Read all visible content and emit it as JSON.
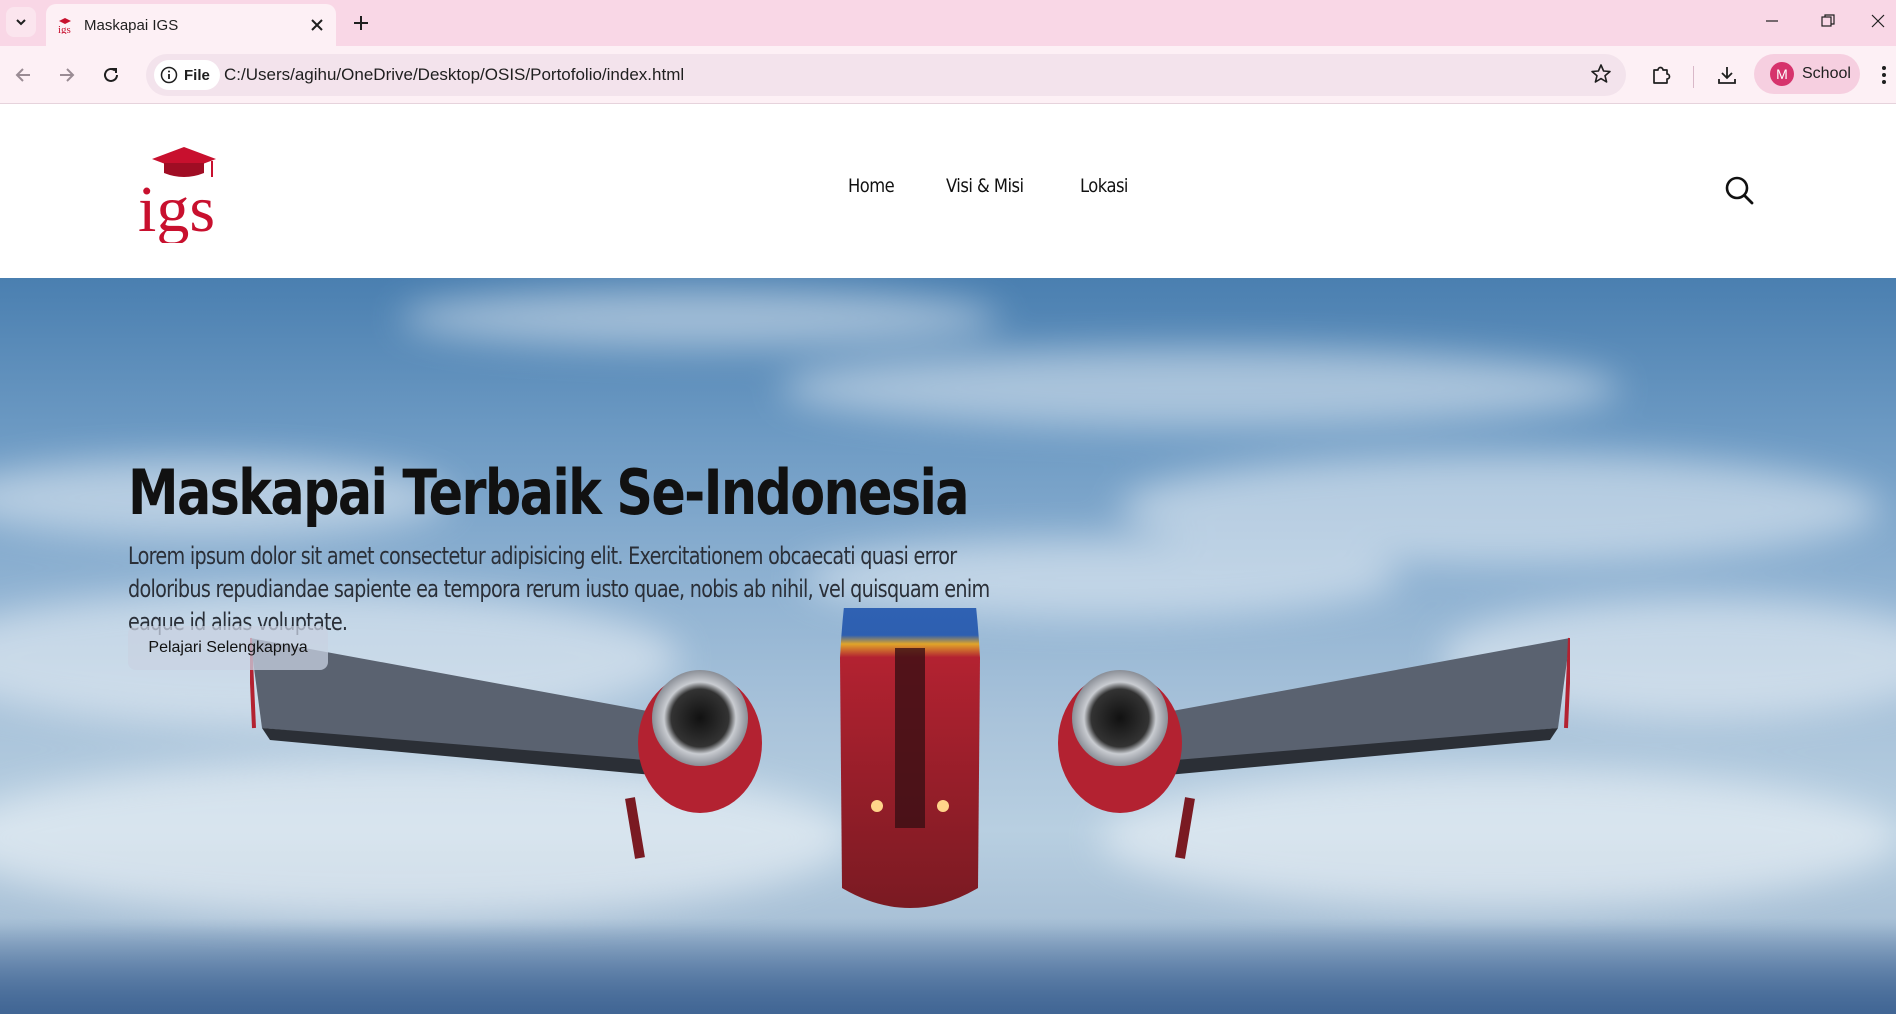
{
  "browser": {
    "tab_title": "Maskapai IGS",
    "site_chip_label": "File",
    "url": "C:/Users/agihu/OneDrive/Desktop/OSIS/Portofolio/index.html",
    "profile_initial": "M",
    "profile_name": "School"
  },
  "header": {
    "logo_text": "igs",
    "nav": [
      "Home",
      "Visi & Misi",
      "Lokasi"
    ]
  },
  "hero": {
    "title": "Maskapai Terbaik Se-Indonesia",
    "description": "Lorem ipsum dolor sit amet consectetur adipisicing elit. Exercitationem obcaecati quasi error doloribus repudiandae sapiente ea tempora rerum iusto quae, nobis ab nihil, vel quisquam enim eaque id alias voluptate.",
    "button_label": "Pelajari Selengkapnya"
  },
  "colors": {
    "tabbar": "#f9d7e6",
    "toolbar": "#fdf0f5",
    "logo_red": "#c8102e",
    "profile_avatar": "#d6336c"
  }
}
